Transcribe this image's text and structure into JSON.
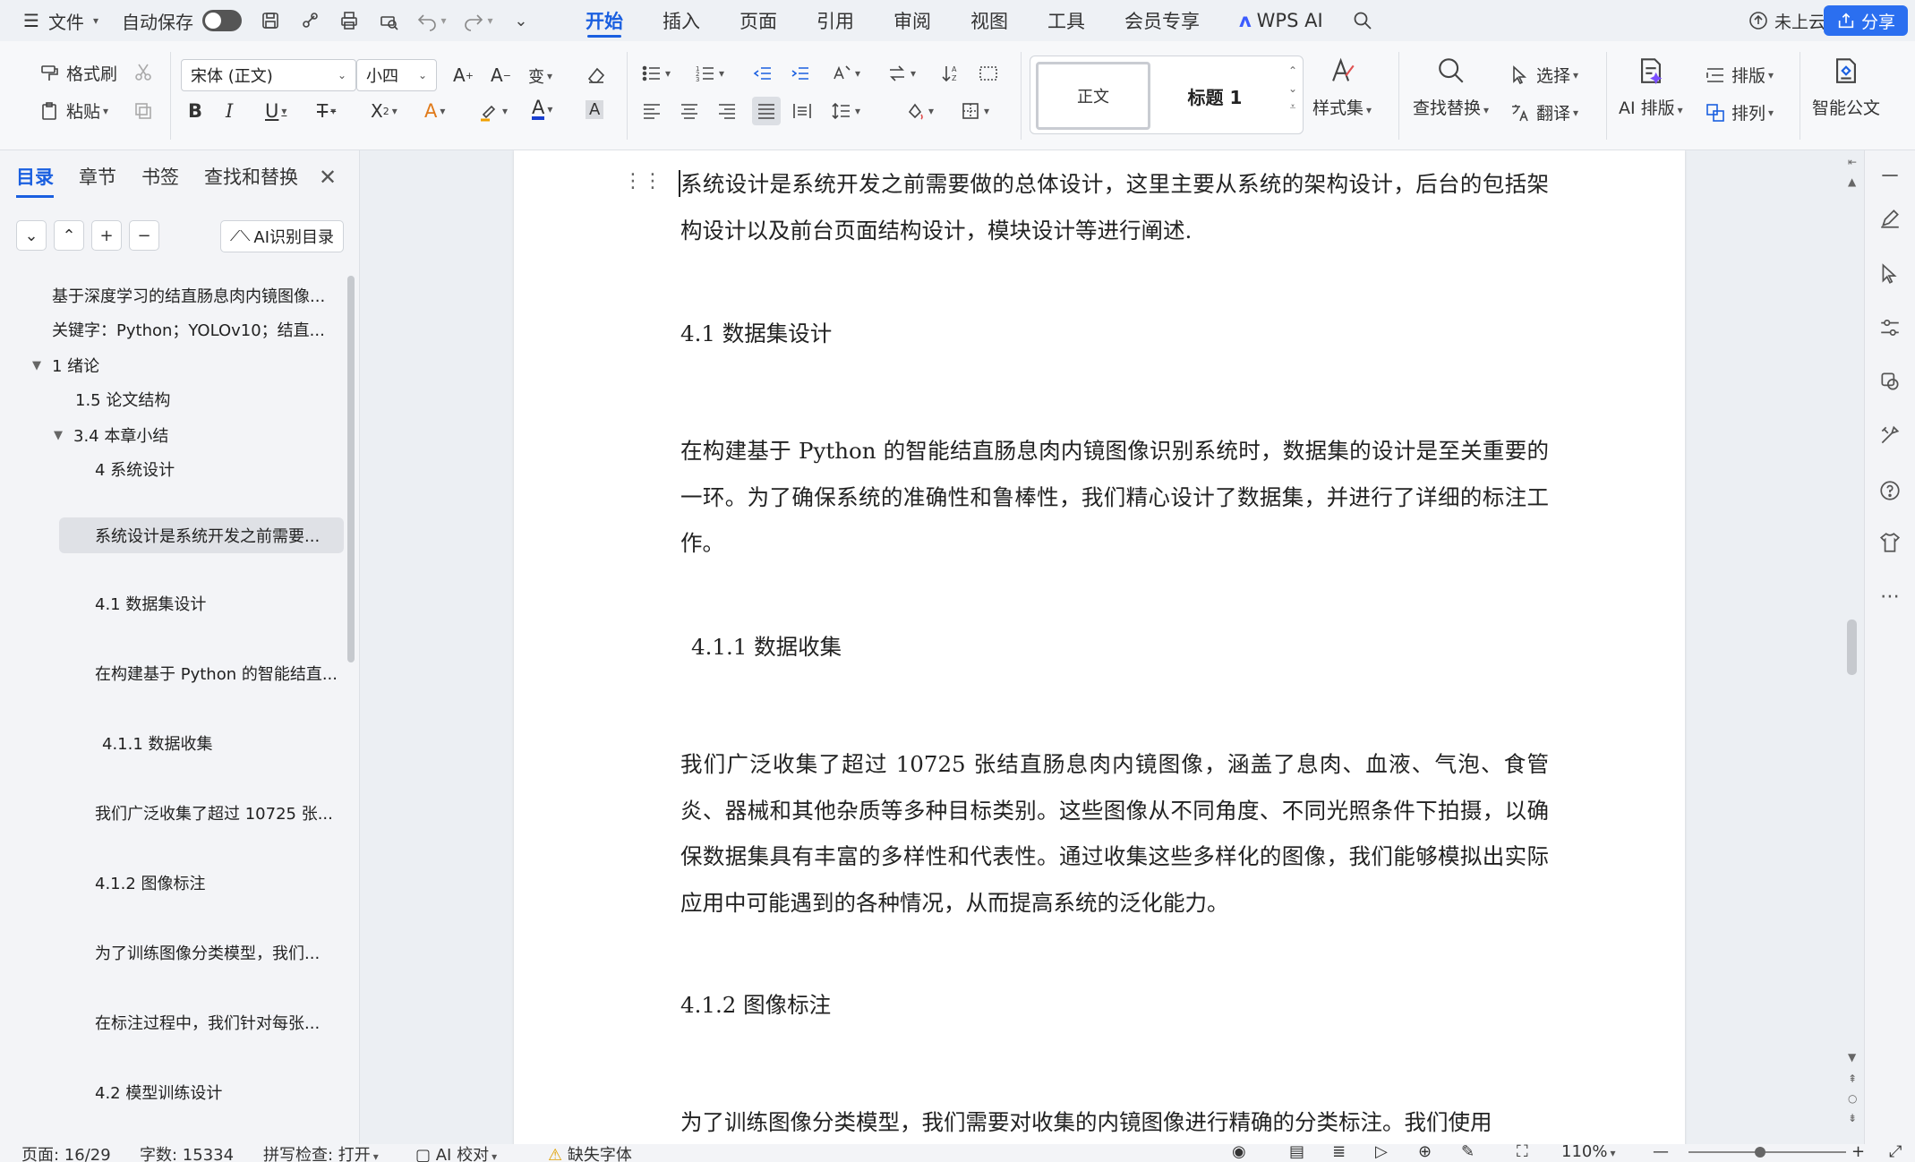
{
  "menubar": {
    "file_label": "文件",
    "autosave_label": "自动保存",
    "tabs": [
      "开始",
      "插入",
      "页面",
      "引用",
      "审阅",
      "视图",
      "工具",
      "会员专享",
      "WPS AI"
    ],
    "active_tab": "开始",
    "cloud_label": "未上云",
    "share_label": "分享"
  },
  "ribbon": {
    "format_painter": "格式刷",
    "paste": "粘贴",
    "font_name": "宋体 (正文)",
    "font_size": "小四",
    "style_normal": "正文",
    "style_heading1": "标题 1",
    "style_set": "样式集",
    "find_replace": "查找替换",
    "select": "选择",
    "translate": "翻译",
    "ai_layout": "AI 排版",
    "layout": "排版",
    "arrange": "排列",
    "smart_doc": "智能公文",
    "bold": "B",
    "italic": "I",
    "underline": "U",
    "font_color_accent": "#1a3fd0"
  },
  "nav": {
    "tabs": [
      "目录",
      "章节",
      "书签",
      "查找和替换"
    ],
    "active_tab": "目录",
    "ai_toc_label": "AI识别目录",
    "items": [
      {
        "label": "基于深度学习的结直肠息肉内镜图像..."
      },
      {
        "label": "关键字：Python；YOLOv10；结直..."
      },
      {
        "label": "1  绪论"
      },
      {
        "label": "1.5 论文结构"
      },
      {
        "label": "3.4 本章小结"
      },
      {
        "label": "4  系统设计"
      },
      {
        "label": "系统设计是系统开发之前需要..."
      },
      {
        "label": "4.1  数据集设计"
      },
      {
        "label": "在构建基于 Python 的智能结直..."
      },
      {
        "label": "4.1.1  数据收集"
      },
      {
        "label": "我们广泛收集了超过 10725 张..."
      },
      {
        "label": "4.1.2  图像标注"
      },
      {
        "label": "为了训练图像分类模型，我们..."
      },
      {
        "label": "在标注过程中，我们针对每张..."
      },
      {
        "label": "4.2  模型训练设计"
      }
    ]
  },
  "document": {
    "para1": "系统设计是系统开发之前需要做的总体设计，这里主要从系统的架构设计，后台的包括架构设计以及前台页面结构设计，模块设计等进行阐述.",
    "heading_41": "4.1  数据集设计",
    "para2": "在构建基于 Python 的智能结直肠息肉内镜图像识别系统时，数据集的设计是至关重要的一环。为了确保系统的准确性和鲁棒性，我们精心设计了数据集，并进行了详细的标注工作。",
    "heading_411": "4.1.1  数据收集",
    "para3": "我们广泛收集了超过 10725 张结直肠息肉内镜图像，涵盖了息肉、血液、气泡、食管炎、器械和其他杂质等多种目标类别。这些图像从不同角度、不同光照条件下拍摄，以确保数据集具有丰富的多样性和代表性。通过收集这些多样化的图像，我们能够模拟出实际应用中可能遇到的各种情况，从而提高系统的泛化能力。",
    "heading_412": "4.1.2  图像标注",
    "para4": "为了训练图像分类模型，我们需要对收集的内镜图像进行精确的分类标注。我们使用"
  },
  "statusbar": {
    "page": "页面: 16/29",
    "words": "字数: 15334",
    "spell": "拼写检查: 打开",
    "ai_proof": "AI 校对",
    "missing_font": "缺失字体",
    "zoom": "110%"
  }
}
